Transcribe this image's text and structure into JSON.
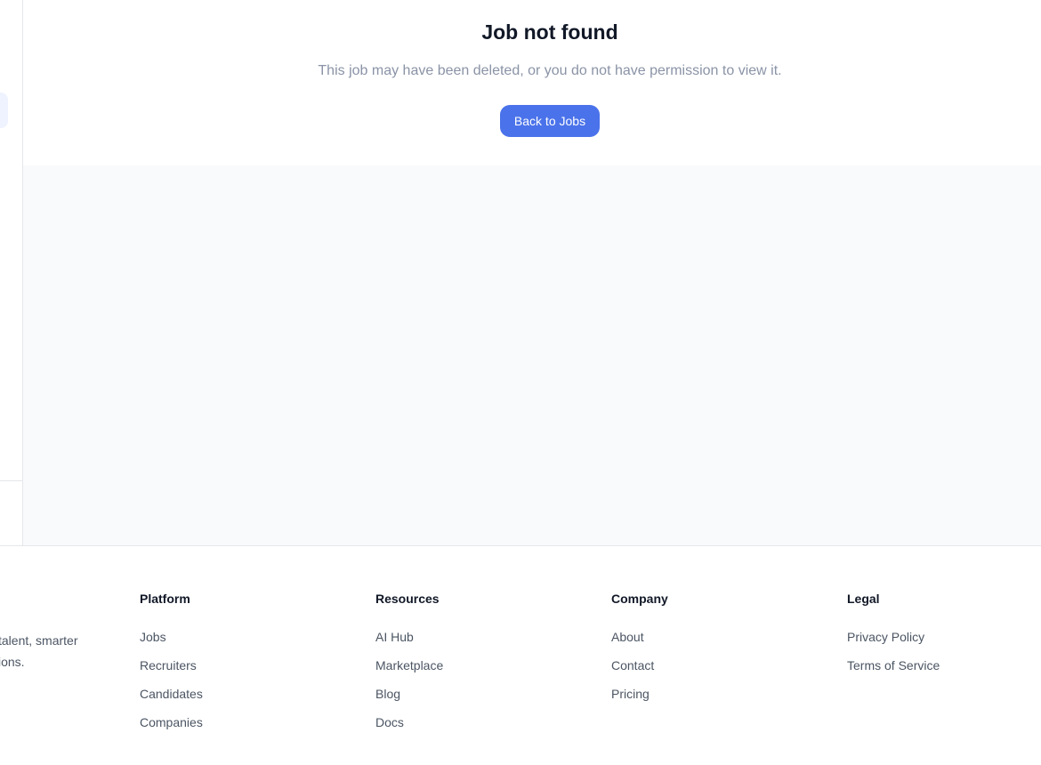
{
  "not_found": {
    "title": "Job not found",
    "message": "This job may have been deleted, or you do not have permission to view it.",
    "back_button_label": "Back to Jobs"
  },
  "footer": {
    "tagline": "l talent, smarter sions.",
    "tagline_line1": "l talent, smarter",
    "tagline_line2": "sions.",
    "columns": [
      {
        "heading": "Platform",
        "links": [
          "Jobs",
          "Recruiters",
          "Candidates",
          "Companies"
        ]
      },
      {
        "heading": "Resources",
        "links": [
          "AI Hub",
          "Marketplace",
          "Blog",
          "Docs"
        ]
      },
      {
        "heading": "Company",
        "links": [
          "About",
          "Contact",
          "Pricing"
        ]
      },
      {
        "heading": "Legal",
        "links": [
          "Privacy Policy",
          "Terms of Service"
        ]
      }
    ]
  },
  "colors": {
    "accent": "#4a72ea",
    "sidebar_active_bg": "#eef3ff",
    "main_bg": "#f9fafb",
    "muted_text": "#8a93a6"
  }
}
